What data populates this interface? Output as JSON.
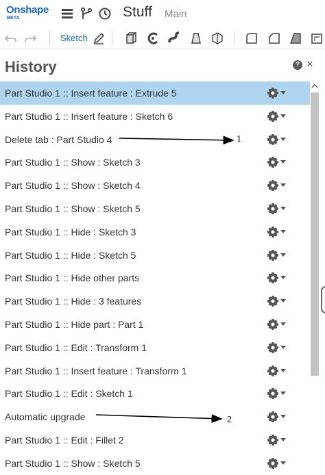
{
  "app": {
    "logo_text": "Onshape",
    "logo_badge": "BETA",
    "document_title": "Stuff",
    "workspace": "Main"
  },
  "topbar_icons": [
    "menu-icon",
    "branch-icon",
    "clock-icon"
  ],
  "toolbar": {
    "undo_icon": "undo-icon",
    "redo_icon": "redo-icon",
    "sketch_label": "Sketch",
    "feature_icons": [
      "sketch-pencil-icon",
      "extrude-icon",
      "revolve-icon",
      "sweep-icon",
      "loft-icon",
      "thicken-icon",
      "fillet-icon",
      "chamfer-icon",
      "draft-icon",
      "shell-icon"
    ]
  },
  "history": {
    "title": "History",
    "items": [
      {
        "label": "Part Studio 1 :: Insert feature : Extrude 5",
        "selected": true
      },
      {
        "label": "Part Studio 1 :: Insert feature : Sketch 6"
      },
      {
        "label": "Delete tab : Part Studio 4"
      },
      {
        "label": "Part Studio 1 :: Show : Sketch 3"
      },
      {
        "label": "Part Studio 1 :: Show : Sketch 4"
      },
      {
        "label": "Part Studio 1 :: Show : Sketch 5"
      },
      {
        "label": "Part Studio 1 :: Hide : Sketch 3"
      },
      {
        "label": "Part Studio 1 :: Hide : Sketch 5"
      },
      {
        "label": "Part Studio 1 :: Hide other parts"
      },
      {
        "label": "Part Studio 1 :: Hide : 3 features"
      },
      {
        "label": "Part Studio 1 :: Hide part : Part 1"
      },
      {
        "label": "Part Studio 1 :: Edit : Transform 1"
      },
      {
        "label": "Part Studio 1 :: Insert feature : Transform 1"
      },
      {
        "label": "Part Studio 1 :: Edit : Sketch 1"
      },
      {
        "label": "Automatic upgrade"
      },
      {
        "label": "Part Studio 1 :: Edit : Fillet 2"
      },
      {
        "label": "Part Studio 1 :: Show : Sketch 5"
      }
    ]
  },
  "annotations": [
    {
      "number": "1",
      "points_to": "Delete tab : Part Studio 4"
    },
    {
      "number": "2",
      "points_to": "Automatic upgrade"
    }
  ],
  "colors": {
    "brand": "#1a66b8",
    "selected_row": "#aed4f0",
    "scrollbar": "#c3c3c3"
  }
}
